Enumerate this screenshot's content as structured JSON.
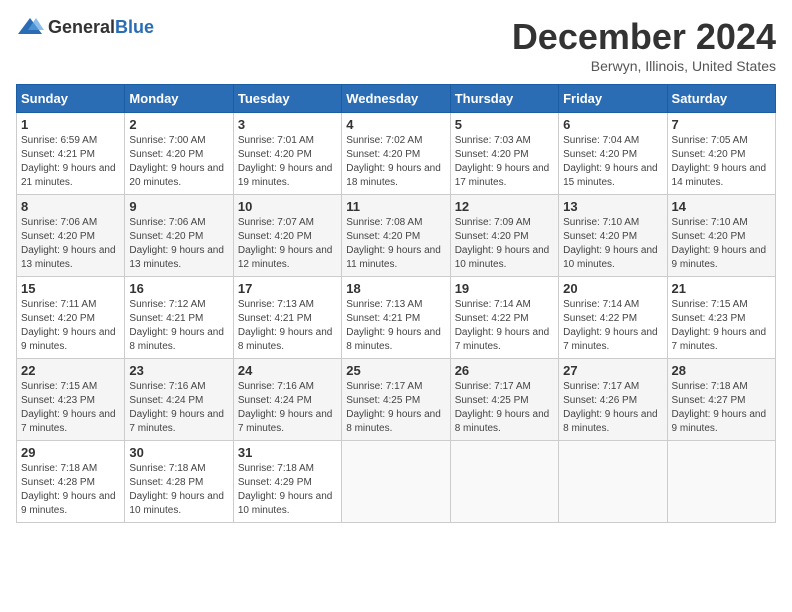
{
  "logo": {
    "general": "General",
    "blue": "Blue"
  },
  "title": {
    "month": "December 2024",
    "location": "Berwyn, Illinois, United States"
  },
  "weekdays": [
    "Sunday",
    "Monday",
    "Tuesday",
    "Wednesday",
    "Thursday",
    "Friday",
    "Saturday"
  ],
  "weeks": [
    [
      {
        "day": 1,
        "sunrise": "6:59 AM",
        "sunset": "4:21 PM",
        "daylight": "9 hours and 21 minutes."
      },
      {
        "day": 2,
        "sunrise": "7:00 AM",
        "sunset": "4:20 PM",
        "daylight": "9 hours and 20 minutes."
      },
      {
        "day": 3,
        "sunrise": "7:01 AM",
        "sunset": "4:20 PM",
        "daylight": "9 hours and 19 minutes."
      },
      {
        "day": 4,
        "sunrise": "7:02 AM",
        "sunset": "4:20 PM",
        "daylight": "9 hours and 18 minutes."
      },
      {
        "day": 5,
        "sunrise": "7:03 AM",
        "sunset": "4:20 PM",
        "daylight": "9 hours and 17 minutes."
      },
      {
        "day": 6,
        "sunrise": "7:04 AM",
        "sunset": "4:20 PM",
        "daylight": "9 hours and 15 minutes."
      },
      {
        "day": 7,
        "sunrise": "7:05 AM",
        "sunset": "4:20 PM",
        "daylight": "9 hours and 14 minutes."
      }
    ],
    [
      {
        "day": 8,
        "sunrise": "7:06 AM",
        "sunset": "4:20 PM",
        "daylight": "9 hours and 13 minutes."
      },
      {
        "day": 9,
        "sunrise": "7:06 AM",
        "sunset": "4:20 PM",
        "daylight": "9 hours and 13 minutes."
      },
      {
        "day": 10,
        "sunrise": "7:07 AM",
        "sunset": "4:20 PM",
        "daylight": "9 hours and 12 minutes."
      },
      {
        "day": 11,
        "sunrise": "7:08 AM",
        "sunset": "4:20 PM",
        "daylight": "9 hours and 11 minutes."
      },
      {
        "day": 12,
        "sunrise": "7:09 AM",
        "sunset": "4:20 PM",
        "daylight": "9 hours and 10 minutes."
      },
      {
        "day": 13,
        "sunrise": "7:10 AM",
        "sunset": "4:20 PM",
        "daylight": "9 hours and 10 minutes."
      },
      {
        "day": 14,
        "sunrise": "7:10 AM",
        "sunset": "4:20 PM",
        "daylight": "9 hours and 9 minutes."
      }
    ],
    [
      {
        "day": 15,
        "sunrise": "7:11 AM",
        "sunset": "4:20 PM",
        "daylight": "9 hours and 9 minutes."
      },
      {
        "day": 16,
        "sunrise": "7:12 AM",
        "sunset": "4:21 PM",
        "daylight": "9 hours and 8 minutes."
      },
      {
        "day": 17,
        "sunrise": "7:13 AM",
        "sunset": "4:21 PM",
        "daylight": "9 hours and 8 minutes."
      },
      {
        "day": 18,
        "sunrise": "7:13 AM",
        "sunset": "4:21 PM",
        "daylight": "9 hours and 8 minutes."
      },
      {
        "day": 19,
        "sunrise": "7:14 AM",
        "sunset": "4:22 PM",
        "daylight": "9 hours and 7 minutes."
      },
      {
        "day": 20,
        "sunrise": "7:14 AM",
        "sunset": "4:22 PM",
        "daylight": "9 hours and 7 minutes."
      },
      {
        "day": 21,
        "sunrise": "7:15 AM",
        "sunset": "4:23 PM",
        "daylight": "9 hours and 7 minutes."
      }
    ],
    [
      {
        "day": 22,
        "sunrise": "7:15 AM",
        "sunset": "4:23 PM",
        "daylight": "9 hours and 7 minutes."
      },
      {
        "day": 23,
        "sunrise": "7:16 AM",
        "sunset": "4:24 PM",
        "daylight": "9 hours and 7 minutes."
      },
      {
        "day": 24,
        "sunrise": "7:16 AM",
        "sunset": "4:24 PM",
        "daylight": "9 hours and 7 minutes."
      },
      {
        "day": 25,
        "sunrise": "7:17 AM",
        "sunset": "4:25 PM",
        "daylight": "9 hours and 8 minutes."
      },
      {
        "day": 26,
        "sunrise": "7:17 AM",
        "sunset": "4:25 PM",
        "daylight": "9 hours and 8 minutes."
      },
      {
        "day": 27,
        "sunrise": "7:17 AM",
        "sunset": "4:26 PM",
        "daylight": "9 hours and 8 minutes."
      },
      {
        "day": 28,
        "sunrise": "7:18 AM",
        "sunset": "4:27 PM",
        "daylight": "9 hours and 9 minutes."
      }
    ],
    [
      {
        "day": 29,
        "sunrise": "7:18 AM",
        "sunset": "4:28 PM",
        "daylight": "9 hours and 9 minutes."
      },
      {
        "day": 30,
        "sunrise": "7:18 AM",
        "sunset": "4:28 PM",
        "daylight": "9 hours and 10 minutes."
      },
      {
        "day": 31,
        "sunrise": "7:18 AM",
        "sunset": "4:29 PM",
        "daylight": "9 hours and 10 minutes."
      },
      null,
      null,
      null,
      null
    ]
  ]
}
